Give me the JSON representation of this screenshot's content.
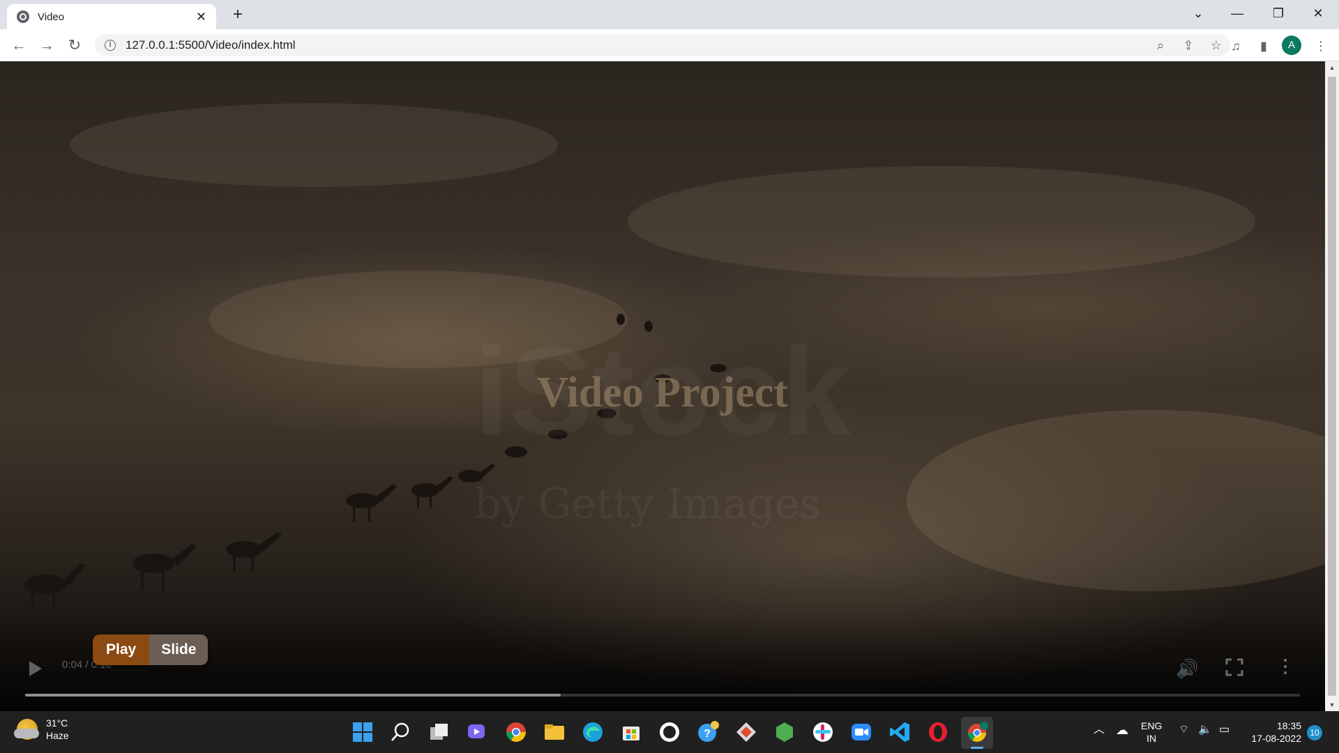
{
  "browser": {
    "tab_title": "Video",
    "url": "127.0.0.1:5500/Video/index.html",
    "profile_initial": "A"
  },
  "video": {
    "title": "Video Project",
    "watermark": "iStock",
    "watermark_sub": "by Getty Images",
    "timecode": "0:04 / 0:10",
    "progress_fraction": 0.42
  },
  "buttons": {
    "play_label": "Play",
    "slide_label": "Slide"
  },
  "taskbar": {
    "temperature": "31°C",
    "weather": "Haze",
    "lang_top": "ENG",
    "lang_bottom": "IN",
    "time": "18:35",
    "date": "17-08-2022",
    "notifications": "10"
  }
}
